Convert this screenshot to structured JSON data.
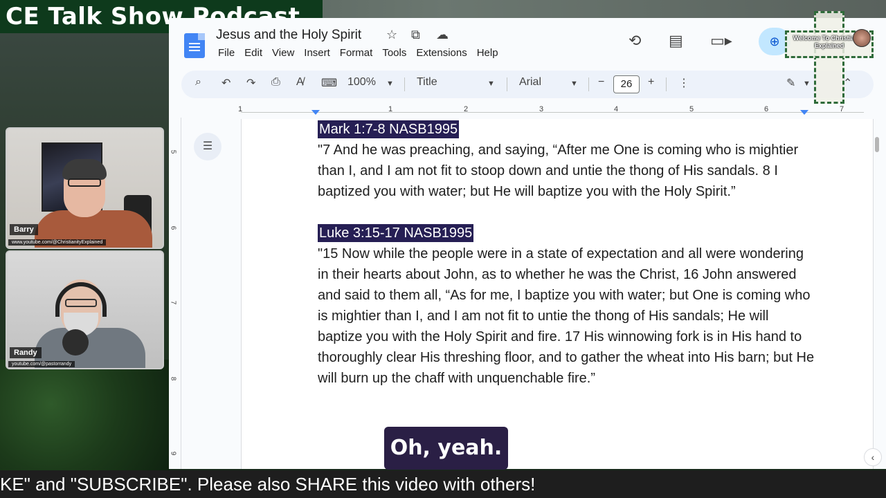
{
  "overlay": {
    "podcast_title": "CE Talk Show Podcast",
    "caption": "Oh, yeah.",
    "ticker": "KE\" and \"SUBSCRIBE\". Please also SHARE this video with others!",
    "logo_text": "Welcome To Christianity Explained"
  },
  "cams": [
    {
      "name": "Barry",
      "url": "www.youtube.com/@ChristianityExplained"
    },
    {
      "name": "Randy",
      "url": "youtube.com/@pastorrandy"
    }
  ],
  "docs": {
    "title": "Jesus and the Holy Spirit",
    "menu": [
      "File",
      "Edit",
      "View",
      "Insert",
      "Format",
      "Tools",
      "Extensions",
      "Help"
    ],
    "toolbar": {
      "zoom": "100%",
      "style": "Title",
      "font": "Arial",
      "font_size": "26",
      "minus": "−",
      "plus": "+"
    },
    "ruler_numbers": [
      "1",
      "1",
      "2",
      "3",
      "4",
      "5",
      "6",
      "7"
    ],
    "vruler_numbers": [
      "5",
      "6",
      "7",
      "8",
      "9"
    ],
    "content": [
      {
        "heading": "Mark 1:7-8 NASB1995",
        "text": "\"7 And he was preaching, and saying, “After me One is coming who is mightier than I, and I am not fit to stoop down and untie the thong of His sandals. 8 I baptized you with water; but He will baptize you with the Holy Spirit.”"
      },
      {
        "heading": "Luke 3:15-17 NASB1995",
        "text": "\"15 Now while the people were in a state of expectation and all were wondering in their hearts about John, as to whether he was the Christ, 16 John answered and said to them all, “As for me, I baptize you with water; but One is coming who is mightier than I, and I am not fit to untie the thong of His sandals; He will baptize you with the Holy Spirit and fire. 17 His winnowing fork is in His hand to thoroughly clear His threshing floor, and to gather the wheat into His barn; but He will burn up the chaff with unquenchable fire.”"
      }
    ]
  }
}
